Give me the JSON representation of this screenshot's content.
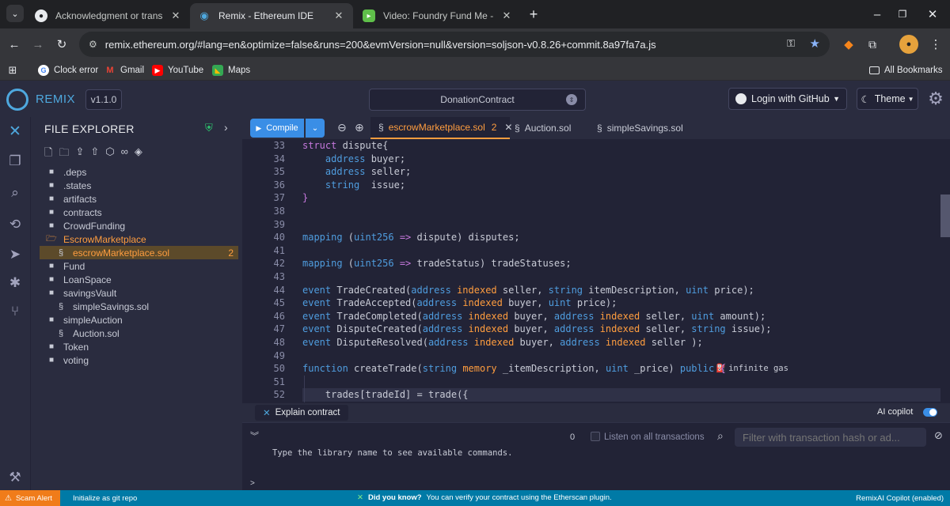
{
  "browser": {
    "tabs": [
      {
        "label": "Acknowledgment or transition",
        "active": false
      },
      {
        "label": "Remix - Ethereum IDE",
        "active": true
      },
      {
        "label": "Video: Foundry Fund Me - Foun",
        "active": false
      }
    ],
    "url": "remix.ethereum.org/#lang=en&optimize=false&runs=200&evmVersion=null&version=soljson-v0.8.26+commit.8a97fa7a.js",
    "bookmarks": [
      {
        "label": "Clock error"
      },
      {
        "label": "Gmail"
      },
      {
        "label": "YouTube"
      },
      {
        "label": "Maps"
      }
    ],
    "all_bookmarks": "All Bookmarks"
  },
  "remix": {
    "logo_text": "REMIX",
    "version": "v1.1.0",
    "workspace_selector": "DonationContract",
    "login_label": "Login with GitHub",
    "theme_label": "Theme"
  },
  "file_explorer": {
    "title": "FILE EXPLORER",
    "items": [
      {
        "label": ".deps",
        "type": "folder"
      },
      {
        "label": ".states",
        "type": "folder"
      },
      {
        "label": "artifacts",
        "type": "folder"
      },
      {
        "label": "contracts",
        "type": "folder"
      },
      {
        "label": "CrowdFunding",
        "type": "folder"
      },
      {
        "label": "EscrowMarketplace",
        "type": "folder-open"
      },
      {
        "label": "escrowMarketplace.sol",
        "type": "file",
        "badge": "2"
      },
      {
        "label": "Fund",
        "type": "folder"
      },
      {
        "label": "LoanSpace",
        "type": "folder"
      },
      {
        "label": "savingsVault",
        "type": "folder"
      },
      {
        "label": "simpleSavings.sol",
        "type": "file"
      },
      {
        "label": "simpleAuction",
        "type": "folder"
      },
      {
        "label": "Auction.sol",
        "type": "file"
      },
      {
        "label": "Token",
        "type": "folder"
      },
      {
        "label": "voting",
        "type": "folder"
      }
    ]
  },
  "editor": {
    "compile_label": "Compile",
    "tabs": [
      {
        "label": "escrowMarketplace.sol",
        "badge": "2",
        "active": true
      },
      {
        "label": "Auction.sol",
        "active": false
      },
      {
        "label": "simpleSavings.sol",
        "active": false
      }
    ],
    "gas_hint": "infinite gas",
    "lines": [
      {
        "n": "33",
        "code": [
          [
            "kw",
            "struct "
          ],
          [
            "pl",
            "dispute{"
          ]
        ]
      },
      {
        "n": "34",
        "code": [
          [
            "pl",
            "    "
          ],
          [
            "tp",
            "address "
          ],
          [
            "pl",
            "buyer;"
          ]
        ]
      },
      {
        "n": "35",
        "code": [
          [
            "pl",
            "    "
          ],
          [
            "tp",
            "address "
          ],
          [
            "pl",
            "seller;"
          ]
        ]
      },
      {
        "n": "36",
        "code": [
          [
            "pl",
            "    "
          ],
          [
            "tp",
            "string  "
          ],
          [
            "pl",
            "issue;"
          ]
        ]
      },
      {
        "n": "37",
        "code": [
          [
            "kw",
            "}"
          ]
        ]
      },
      {
        "n": "38",
        "code": []
      },
      {
        "n": "39",
        "code": []
      },
      {
        "n": "40",
        "code": [
          [
            "tp",
            "mapping "
          ],
          [
            "pl",
            "("
          ],
          [
            "tp",
            "uint256 "
          ],
          [
            "kw",
            "=> "
          ],
          [
            "pl",
            "dispute) disputes;"
          ]
        ]
      },
      {
        "n": "41",
        "code": []
      },
      {
        "n": "42",
        "code": [
          [
            "tp",
            "mapping "
          ],
          [
            "pl",
            "("
          ],
          [
            "tp",
            "uint256 "
          ],
          [
            "kw",
            "=> "
          ],
          [
            "pl",
            "tradeStatus) tradeStatuses;"
          ]
        ]
      },
      {
        "n": "43",
        "code": []
      },
      {
        "n": "44",
        "code": [
          [
            "tp",
            "event "
          ],
          [
            "pl",
            "TradeCreated("
          ],
          [
            "tp",
            "address "
          ],
          [
            "kw2",
            "indexed "
          ],
          [
            "pl",
            "seller, "
          ],
          [
            "tp",
            "string "
          ],
          [
            "pl",
            "itemDescription, "
          ],
          [
            "tp",
            "uint "
          ],
          [
            "pl",
            "price);"
          ]
        ]
      },
      {
        "n": "45",
        "code": [
          [
            "tp",
            "event "
          ],
          [
            "pl",
            "TradeAccepted("
          ],
          [
            "tp",
            "address "
          ],
          [
            "kw2",
            "indexed "
          ],
          [
            "pl",
            "buyer, "
          ],
          [
            "tp",
            "uint "
          ],
          [
            "pl",
            "price);"
          ]
        ]
      },
      {
        "n": "46",
        "code": [
          [
            "tp",
            "event "
          ],
          [
            "pl",
            "TradeCompleted("
          ],
          [
            "tp",
            "address "
          ],
          [
            "kw2",
            "indexed "
          ],
          [
            "pl",
            "buyer, "
          ],
          [
            "tp",
            "address "
          ],
          [
            "kw2",
            "indexed "
          ],
          [
            "pl",
            "seller, "
          ],
          [
            "tp",
            "uint "
          ],
          [
            "pl",
            "amount);"
          ]
        ]
      },
      {
        "n": "47",
        "code": [
          [
            "tp",
            "event "
          ],
          [
            "pl",
            "DisputeCreated("
          ],
          [
            "tp",
            "address "
          ],
          [
            "kw2",
            "indexed "
          ],
          [
            "pl",
            "buyer, "
          ],
          [
            "tp",
            "address "
          ],
          [
            "kw2",
            "indexed "
          ],
          [
            "pl",
            "seller, "
          ],
          [
            "tp",
            "string "
          ],
          [
            "pl",
            "issue);"
          ]
        ]
      },
      {
        "n": "48",
        "code": [
          [
            "tp",
            "event "
          ],
          [
            "pl",
            "DisputeResolved("
          ],
          [
            "tp",
            "address "
          ],
          [
            "kw2",
            "indexed "
          ],
          [
            "pl",
            "buyer, "
          ],
          [
            "tp",
            "address "
          ],
          [
            "kw2",
            "indexed "
          ],
          [
            "pl",
            "seller );"
          ]
        ]
      },
      {
        "n": "49",
        "code": []
      },
      {
        "n": "50",
        "code": [
          [
            "tp",
            "function "
          ],
          [
            "pl",
            "createTrade("
          ],
          [
            "tp",
            "string "
          ],
          [
            "kw2",
            "memory "
          ],
          [
            "pl",
            "_itemDescription, "
          ],
          [
            "tp",
            "uint "
          ],
          [
            "pl",
            "_price) "
          ],
          [
            "tp",
            "public "
          ],
          [
            "kw",
            "{"
          ]
        ]
      },
      {
        "n": "51",
        "code": []
      },
      {
        "n": "52",
        "code": [
          [
            "pl",
            "    trades[tradeId] = trade({"
          ]
        ]
      }
    ]
  },
  "terminal": {
    "explain_label": "Explain contract",
    "copilot_label": "AI copilot",
    "count": "0",
    "listen_label": "Listen on all transactions",
    "filter_placeholder": "Filter with transaction hash or ad...",
    "hint": "Type the library name to see available commands.",
    "prompt": ">"
  },
  "statusbar": {
    "scam_alert": "Scam Alert",
    "git": "Initialize as git repo",
    "did_you_know": "Did you know?",
    "tip": "You can verify your contract using the Etherscan plugin.",
    "copilot": "RemixAI Copilot (enabled)"
  }
}
